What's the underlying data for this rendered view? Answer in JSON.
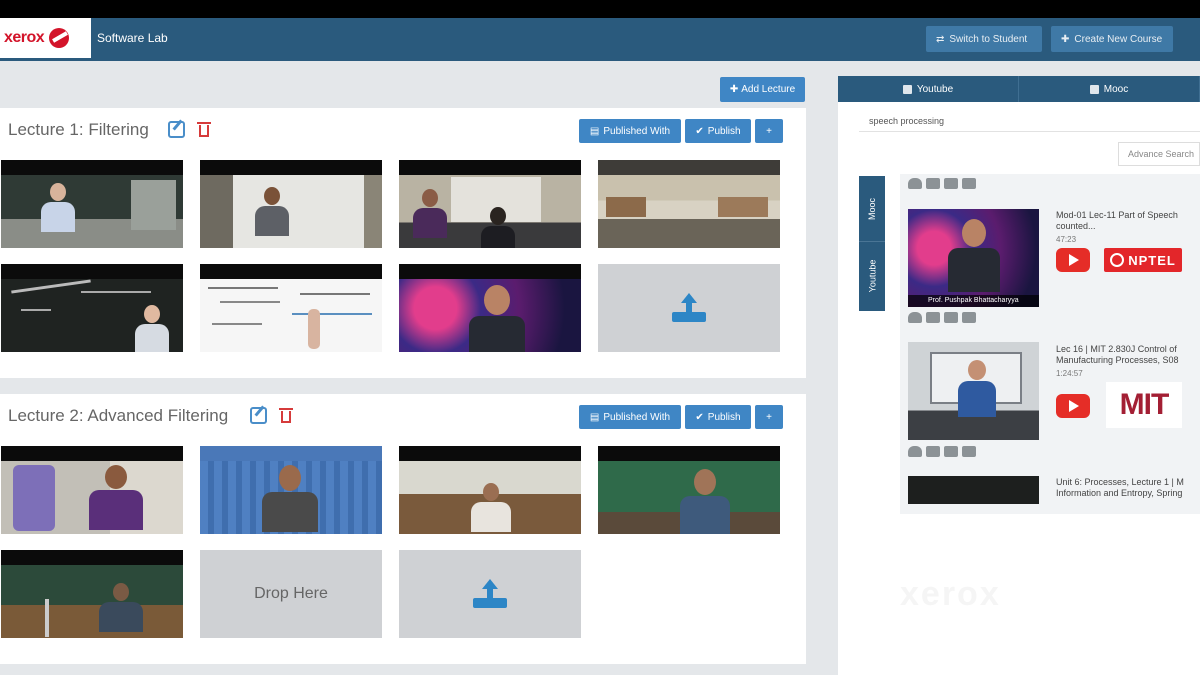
{
  "brand": {
    "logo": "xerox",
    "app_name": "Software Lab"
  },
  "nav": {
    "switch_label": "Switch to Student",
    "create_label": "Create New Course"
  },
  "toolbar": {
    "add_lecture_label": "Add Lecture"
  },
  "lectures": [
    {
      "title": "Lecture 1: Filtering",
      "published_with_label": "Published With",
      "publish_label": "Publish",
      "add_label": "+"
    },
    {
      "title": "Lecture 2: Advanced Filtering",
      "published_with_label": "Published With",
      "publish_label": "Publish",
      "add_label": "+",
      "drop_label": "Drop Here"
    }
  ],
  "search_panel": {
    "source_tabs": [
      "Youtube",
      "Mooc"
    ],
    "query": "speech processing",
    "advance_search_label": "Advance Search",
    "vertical_tabs": [
      "Mooc",
      "Youtube"
    ],
    "results": [
      {
        "title_line1": "Mod-01 Lec-11 Part of Speech",
        "title_line2": "counted...",
        "duration": "47:23",
        "source": "Youtube",
        "provider_badge": "NPTEL",
        "caption": "Prof. Pushpak Bhattacharyya"
      },
      {
        "title_line1": "Lec 16 | MIT 2.830J Control of",
        "title_line2": "Manufacturing Processes, S08",
        "duration": "1:24:57",
        "source": "Youtube",
        "provider_badge": "MIT"
      },
      {
        "title_line1": "Unit 6: Processes, Lecture 1 | M",
        "title_line2": "Information and Entropy, Spring"
      }
    ]
  },
  "watermark": "xerox",
  "colors": {
    "navbar": "#2a5a7d",
    "button": "#3f86c5",
    "brand_red": "#d3142a",
    "youtube_red": "#e52d27",
    "nptel_red": "#e3262a",
    "mit_red": "#a31f34",
    "placeholder_gray": "#cfd1d4"
  },
  "icons": [
    "random-icon",
    "plus-icon",
    "edit-icon",
    "trash-icon",
    "image-icon",
    "check-icon",
    "upload-icon",
    "cloud-icon",
    "grid-icon",
    "document-icon",
    "sitemap-icon",
    "youtube-icon"
  ]
}
